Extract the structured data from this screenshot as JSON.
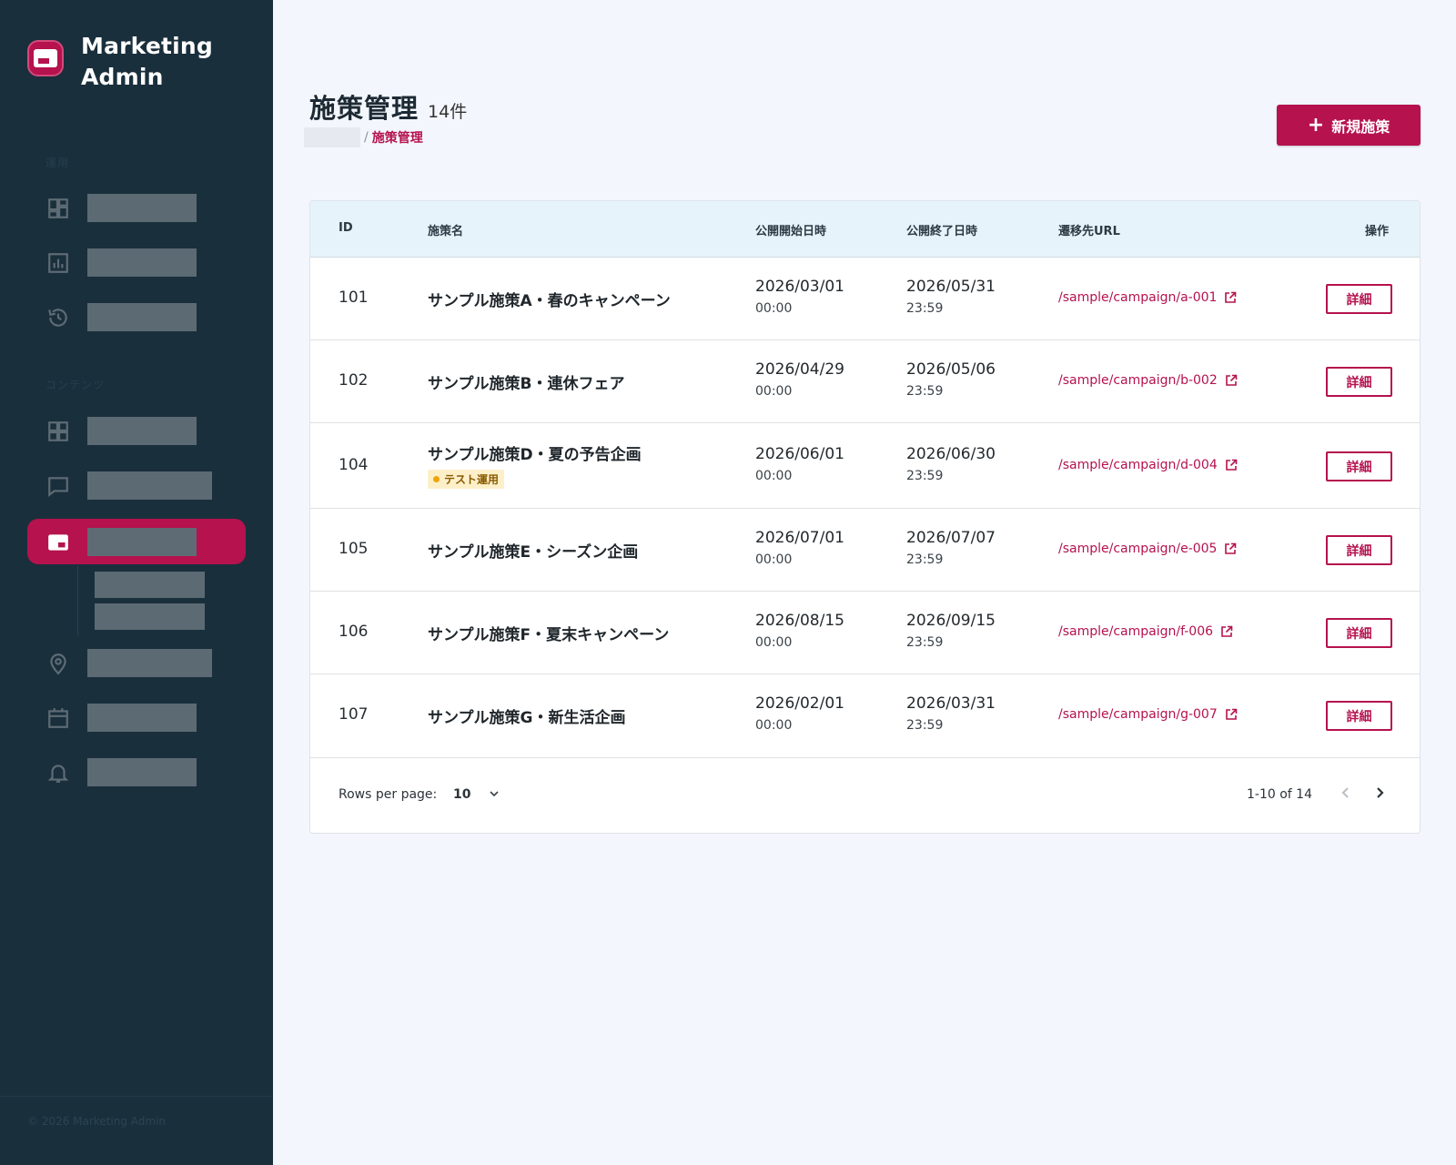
{
  "app": {
    "brand_line1": "Marketing",
    "brand_line2": "Admin",
    "footer": "© 2026 Marketing Admin"
  },
  "sidebar": {
    "section1_label": "運用",
    "section2_label": "コンテンツ",
    "items": [
      {
        "icon": "dashboard-icon"
      },
      {
        "icon": "chart-icon"
      },
      {
        "icon": "history-icon"
      },
      {
        "icon": "grid-icon"
      },
      {
        "icon": "chat-icon"
      },
      {
        "icon": "campaign-icon",
        "active": true
      },
      {
        "icon": "location-icon"
      },
      {
        "icon": "calendar-icon"
      },
      {
        "icon": "bell-icon"
      }
    ]
  },
  "page": {
    "title": "施策管理",
    "count": "14件",
    "breadcrumb_current": "施策管理",
    "breadcrumb_sep": "/"
  },
  "actions": {
    "new_label": "新規施策",
    "detail_label": "詳細"
  },
  "table": {
    "headers": {
      "id": "ID",
      "name": "施策名",
      "start": "公開開始日時",
      "end": "公開終了日時",
      "url": "遷移先URL",
      "ops": "操作"
    },
    "rows": [
      {
        "id": "101",
        "name": "サンプル施策A・春のキャンペーン",
        "start_date": "2026/03/01",
        "start_time": "00:00",
        "end_date": "2026/05/31",
        "end_time": "23:59",
        "url": "/sample/campaign/a-001"
      },
      {
        "id": "102",
        "name": "サンプル施策B・連休フェア",
        "start_date": "2026/04/29",
        "start_time": "00:00",
        "end_date": "2026/05/06",
        "end_time": "23:59",
        "url": "/sample/campaign/b-002"
      },
      {
        "id": "104",
        "name": "サンプル施策D・夏の予告企画",
        "tag": "テスト運用",
        "start_date": "2026/06/01",
        "start_time": "00:00",
        "end_date": "2026/06/30",
        "end_time": "23:59",
        "url": "/sample/campaign/d-004"
      },
      {
        "id": "105",
        "name": "サンプル施策E・シーズン企画",
        "start_date": "2026/07/01",
        "start_time": "00:00",
        "end_date": "2026/07/07",
        "end_time": "23:59",
        "url": "/sample/campaign/e-005"
      },
      {
        "id": "106",
        "name": "サンプル施策F・夏末キャンペーン",
        "start_date": "2026/08/15",
        "start_time": "00:00",
        "end_date": "2026/09/15",
        "end_time": "23:59",
        "url": "/sample/campaign/f-006"
      },
      {
        "id": "107",
        "name": "サンプル施策G・新生活企画",
        "start_date": "2026/02/01",
        "start_time": "00:00",
        "end_date": "2026/03/31",
        "end_time": "23:59",
        "url": "/sample/campaign/g-007"
      }
    ]
  },
  "pagination": {
    "rows_per_page_label": "Rows per page:",
    "rows_per_page": "10",
    "range": "1-10 of 14"
  },
  "colors": {
    "accent": "#b5124e",
    "sidebar": "#1a2f3c",
    "header": "#e6f3fb",
    "tag_bg": "#fdf0c9",
    "tag_dot": "#f1a30b"
  }
}
